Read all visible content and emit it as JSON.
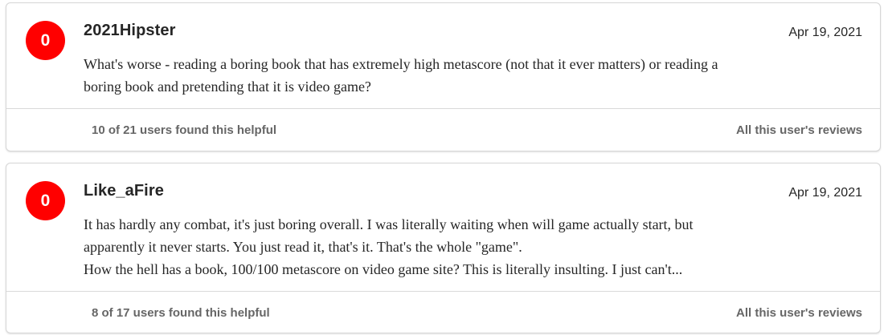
{
  "reviews": [
    {
      "score": "0",
      "score_color": "#ff0000",
      "username": "2021Hipster",
      "date": "Apr 19, 2021",
      "body_lines": [
        "What's worse - reading a boring book that has extremely high metascore (not that it ever matters) or reading a",
        "boring book and pretending that it is video game?"
      ],
      "helpful": "10 of 21 users found this helpful",
      "all_reviews_label": "All this user's reviews"
    },
    {
      "score": "0",
      "score_color": "#ff0000",
      "username": "Like_aFire",
      "date": "Apr 19, 2021",
      "body_lines": [
        "It has hardly any combat, it's just boring overall. I was literally waiting when will game actually start, but",
        "apparently it never starts. You just read it, that's it. That's the whole \"game\".",
        "How the hell has a book, 100/100 metascore on video game site? This is literally insulting. I just can't..."
      ],
      "helpful": "8 of 17 users found this helpful",
      "all_reviews_label": "All this user's reviews"
    }
  ]
}
